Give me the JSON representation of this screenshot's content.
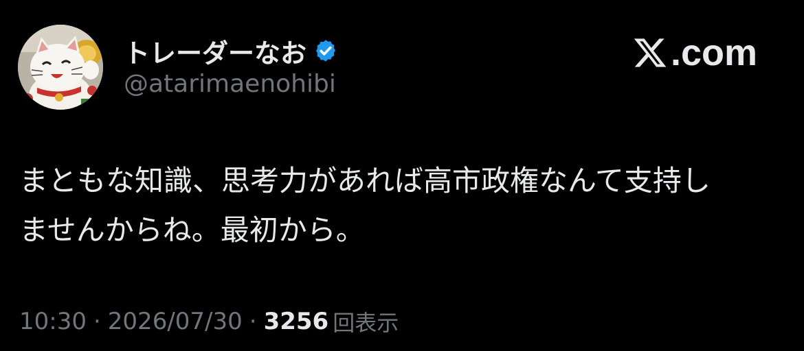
{
  "author": {
    "display_name": "トレーダーなお",
    "handle": "@atarimaenohibi"
  },
  "brand": {
    "text": ".com"
  },
  "tweet": {
    "lines": [
      "まともな知識、思考力があれば高市政権なんて支持し",
      "ませんからね。最初から。"
    ]
  },
  "meta": {
    "time": "10:30",
    "separator": "·",
    "date": "2026/07/30",
    "views_count": "3256",
    "views_label": "回表示"
  },
  "colors": {
    "background": "#000000",
    "text_primary": "#e7e9ea",
    "text_secondary": "#71767b",
    "verified_badge": "#1d9bf0"
  },
  "icons": {
    "verified": "verified-badge-icon",
    "brand": "x-logo-icon",
    "avatar": "maneki-neko-avatar"
  }
}
